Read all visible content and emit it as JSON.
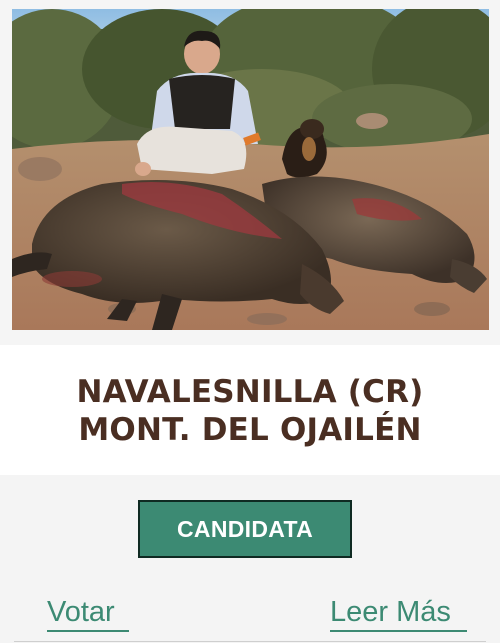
{
  "card": {
    "title_line1": "NAVALESNILLA (CR)",
    "title_line2": "MONT. DEL OJAILÉN",
    "photo_description_icon": "hunting-photo",
    "candidata_label": "CANDIDATA",
    "votar_label": "Votar",
    "leer_mas_label": "Leer Más"
  },
  "colors": {
    "title": "#4a2e22",
    "accent": "#3c8a73",
    "button_border": "#0f2a22"
  }
}
